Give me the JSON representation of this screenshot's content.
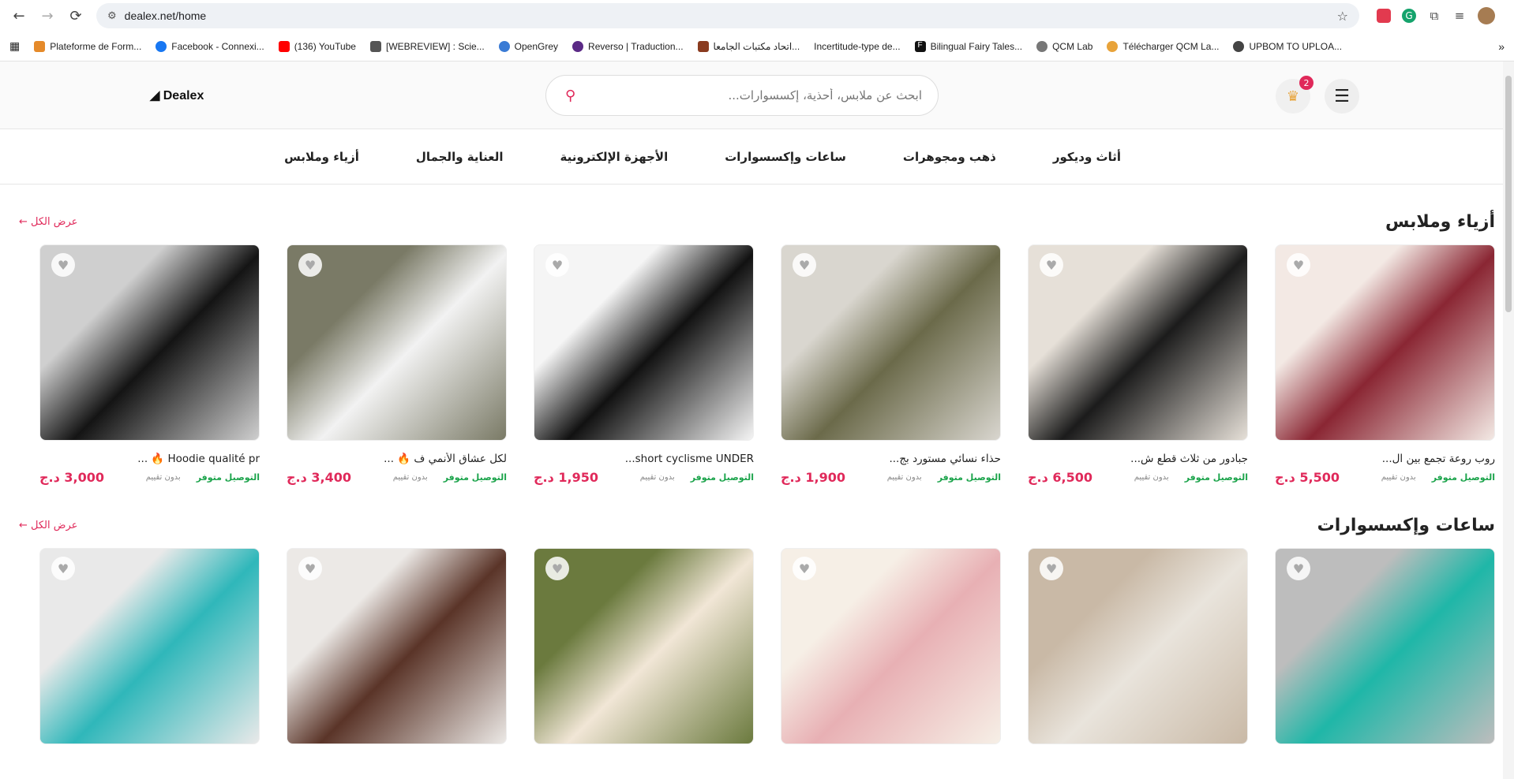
{
  "browser": {
    "url": "dealex.net/home",
    "bookmarks": [
      {
        "label": "Plateforme de Form...",
        "color": "#e58a2a"
      },
      {
        "label": "Facebook - Connexi...",
        "color": "#1877f2"
      },
      {
        "label": "(136) YouTube",
        "color": "#ff0000"
      },
      {
        "label": "[WEBREVIEW] : Scie...",
        "color": "#555555"
      },
      {
        "label": "OpenGrey",
        "color": "#3a7bd5"
      },
      {
        "label": "Reverso | Traduction...",
        "color": "#5b2a86"
      },
      {
        "label": "اتحاد مكتبات الجامعا...",
        "color": "#8a3b1f"
      },
      {
        "label": "Incertitude-type de...",
        "color": "#ffffff"
      },
      {
        "label": "Bilingual Fairy Tales...",
        "color": "#111111"
      },
      {
        "label": "QCM Lab",
        "color": "#777777"
      },
      {
        "label": "Télécharger QCM La...",
        "color": "#e8a33a"
      },
      {
        "label": "UPBOM TO UPLOA...",
        "color": "#444444"
      }
    ]
  },
  "header": {
    "logo": "Dealex",
    "search_placeholder": "ابحث عن ملابس، أحذية، إكسسوارات...",
    "cart_count": "2"
  },
  "categories": [
    "أثاث وديكور",
    "ذهب ومجوهرات",
    "ساعات وإكسسوارات",
    "الأجهزة الإلكترونية",
    "العناية والجمال",
    "أزياء وملابس"
  ],
  "sections": [
    {
      "title": "أزياء وملابس",
      "view_all": "عرض الكل ←",
      "products": [
        {
          "name": "روب روعة تجمع بين ال...",
          "ship": "التوصيل متوفر",
          "rating": "بدون تقييم",
          "price": "5,500 د.ج",
          "bg": "#8a2633",
          "bg2": "#f3e9e4"
        },
        {
          "name": "جبادور من ثلاث قطع ش...",
          "ship": "التوصيل متوفر",
          "rating": "بدون تقييم",
          "price": "6,500 د.ج",
          "bg": "#1b1b1b",
          "bg2": "#e6e0d8"
        },
        {
          "name": "حذاء نسائي مستورد بج...",
          "ship": "التوصيل متوفر",
          "rating": "بدون تقييم",
          "price": "1,900 د.ج",
          "bg": "#6b6a4a",
          "bg2": "#d9d6cf"
        },
        {
          "name": "short cyclisme UNDER...",
          "ship": "التوصيل متوفر",
          "rating": "بدون تقييم",
          "price": "1,950 د.ج",
          "bg": "#111111",
          "bg2": "#f5f5f5"
        },
        {
          "name": "لكل عشاق الأنمي ف 🔥 ...",
          "ship": "التوصيل متوفر",
          "rating": "بدون تقييم",
          "price": "3,400 د.ج",
          "bg": "#f2f2f2",
          "bg2": "#7a7a66"
        },
        {
          "name": "Hoodie qualité pr 🔥 ...",
          "ship": "التوصيل متوفر",
          "rating": "بدون تقييم",
          "price": "3,000 د.ج",
          "bg": "#141414",
          "bg2": "#cfcfcf"
        }
      ]
    },
    {
      "title": "ساعات وإكسسوارات",
      "view_all": "عرض الكل ←",
      "products": [
        {
          "name": "",
          "ship": "",
          "rating": "",
          "price": "",
          "bg": "#1fb7a8",
          "bg2": "#bdbdbd"
        },
        {
          "name": "",
          "ship": "",
          "rating": "",
          "price": "",
          "bg": "#e9e4dc",
          "bg2": "#c9b9a6"
        },
        {
          "name": "",
          "ship": "",
          "rating": "",
          "price": "",
          "bg": "#e8b0b4",
          "bg2": "#f6efe6"
        },
        {
          "name": "",
          "ship": "",
          "rating": "",
          "price": "",
          "bg": "#f1e6d6",
          "bg2": "#6b7a3e"
        },
        {
          "name": "",
          "ship": "",
          "rating": "",
          "price": "",
          "bg": "#5a3428",
          "bg2": "#ece9e6"
        },
        {
          "name": "",
          "ship": "",
          "rating": "",
          "price": "",
          "bg": "#2fb7ba",
          "bg2": "#e9e9e9"
        }
      ]
    }
  ]
}
